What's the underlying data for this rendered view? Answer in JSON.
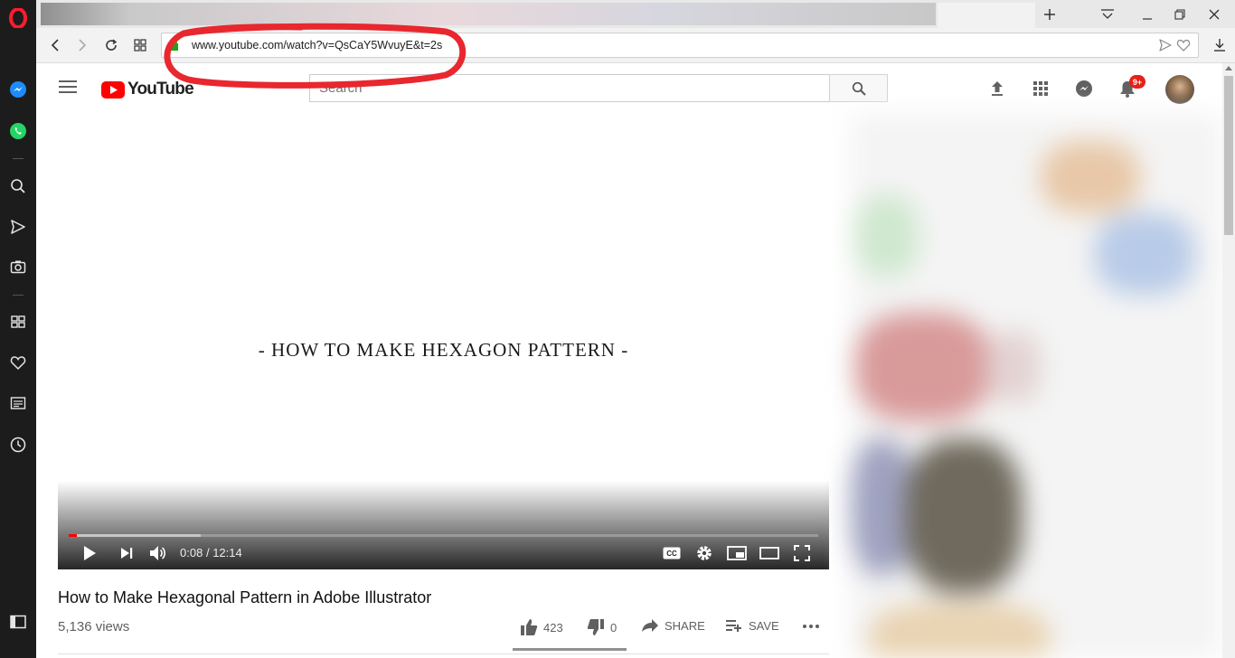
{
  "browser": {
    "address": {
      "url": "www.youtube.com/watch?v=QsCaY5WvuyE&t=2s"
    }
  },
  "youtube": {
    "logo_text": "YouTube",
    "search_placeholder": "Search",
    "notifications_badge": "9+"
  },
  "player": {
    "title_card": "-  HOW TO MAKE HEXAGON PATTERN  -",
    "time_current": "0:08",
    "time_separator": "/",
    "time_total": "12:14",
    "progress_played_fraction": 0.011,
    "progress_buffered_fraction": 0.176
  },
  "video": {
    "title": "How to Make Hexagonal Pattern in Adobe Illustrator",
    "views": "5,136 views",
    "likes": "423",
    "dislikes": "0",
    "share_label": "SHARE",
    "save_label": "SAVE"
  },
  "colors": {
    "yt_red": "#ff0000",
    "annotation_red": "#e8272e",
    "opera_red": "#ff1b2d"
  },
  "icons": {
    "sidebar": [
      "opera-logo-icon",
      "messenger-icon",
      "whatsapp-icon",
      "search-icon",
      "send-icon",
      "camera-icon",
      "speed-dial-icon",
      "heart-icon",
      "news-icon",
      "history-icon",
      "sidebar-toggle-icon"
    ],
    "header": [
      "upload-icon",
      "apps-icon",
      "messages-icon",
      "bell-icon"
    ]
  }
}
